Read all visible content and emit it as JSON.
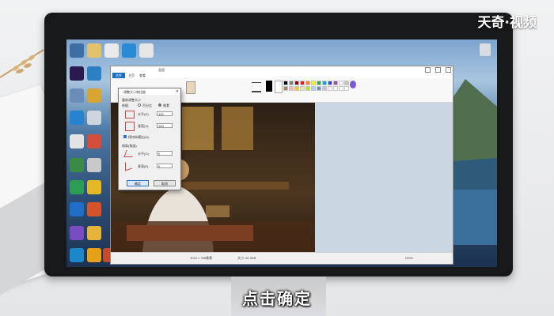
{
  "watermark": "天奇·视频",
  "caption": "点击确定",
  "paint": {
    "title": "画图",
    "menu_file": "文件",
    "menu_home": "主页",
    "menu_view": "查看",
    "status_size": "1024 × 768像素",
    "status_file": "大小: 60.3KB",
    "zoom": "100%"
  },
  "dialog": {
    "title": "调整大小和扭曲",
    "resize_section": "重新调整大小",
    "by_label": "依据:",
    "option_percent": "百分比",
    "option_pixels": "像素",
    "horizontal_label": "水平(H):",
    "horizontal_value": "100",
    "vertical_label": "垂直(V):",
    "vertical_value": "100",
    "keep_ratio": "保持纵横比(M)",
    "skew_section": "倾斜(角度)",
    "skew_h_label": "水平(O):",
    "skew_h_value": "0",
    "skew_v_label": "垂直(E):",
    "skew_v_value": "0",
    "ok": "确定",
    "cancel": "取消"
  },
  "palette_colors": [
    "#000000",
    "#7f7f7f",
    "#880015",
    "#ed1c24",
    "#ff7f27",
    "#fff200",
    "#22b14c",
    "#00a2e8",
    "#3f48cc",
    "#a349a4",
    "#ffffff",
    "#c3c3c3",
    "#b97a57",
    "#ffaec9",
    "#ffc90e",
    "#efe4b0",
    "#b5e61d",
    "#99d9ea",
    "#7092be",
    "#c8bfe7",
    "#ffffff",
    "#ffffff",
    "#ffffff",
    "#ffffff"
  ],
  "accent_color": "#2b73d2"
}
